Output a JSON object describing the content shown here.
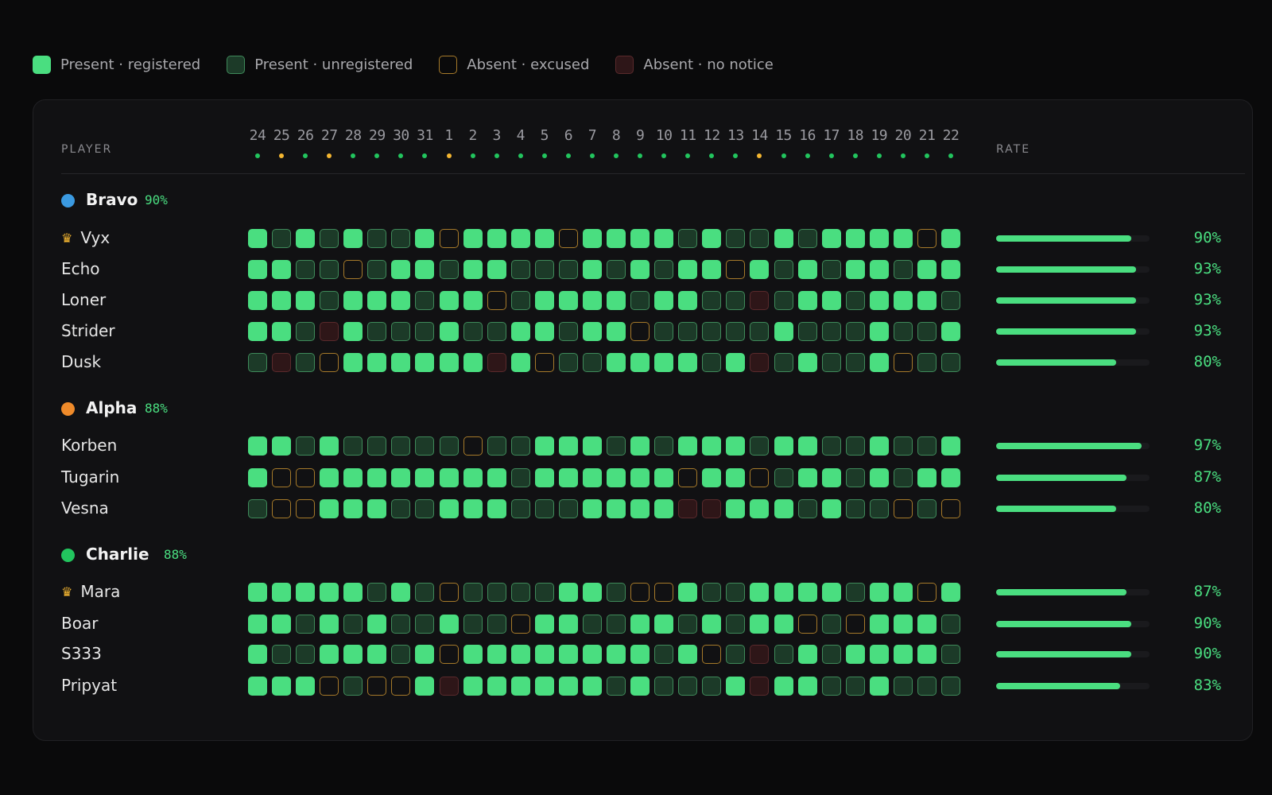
{
  "colors": {
    "registered": "#4ade80",
    "unregistered": "#1c3a28",
    "excused": "#a67a2a",
    "no_notice": "#5a2a2c",
    "dot_green": "#22c55e",
    "dot_amber": "#f5b731"
  },
  "legend": [
    {
      "label": "Present · registered",
      "status": "reg"
    },
    {
      "label": "Present · unregistered",
      "status": "unreg"
    },
    {
      "label": "Absent · excused",
      "status": "exc"
    },
    {
      "label": "Absent · no notice",
      "status": "nonotice"
    }
  ],
  "header": {
    "player": "PLAYER",
    "rate": "RATE"
  },
  "days": [
    "24",
    "25",
    "26",
    "27",
    "28",
    "29",
    "30",
    "31",
    "1",
    "2",
    "3",
    "4",
    "5",
    "6",
    "7",
    "8",
    "9",
    "10",
    "11",
    "12",
    "13",
    "14",
    "15",
    "16",
    "17",
    "18",
    "19",
    "20",
    "21",
    "22"
  ],
  "day_dot_colors": [
    "green",
    "amber",
    "green",
    "amber",
    "green",
    "green",
    "green",
    "green",
    "amber",
    "green",
    "green",
    "green",
    "green",
    "green",
    "green",
    "green",
    "green",
    "green",
    "green",
    "green",
    "green",
    "amber",
    "green",
    "green",
    "green",
    "green",
    "green",
    "green",
    "green",
    "green"
  ],
  "groups": [
    {
      "name": "Bravo",
      "pct": "90%",
      "color": "#3b9ae1",
      "players": [
        {
          "name": "Vyx",
          "crown": true,
          "rate": "90%",
          "rate_value": 0.9,
          "days": [
            "reg",
            "unreg",
            "reg",
            "unreg",
            "reg",
            "unreg",
            "unreg",
            "reg",
            "exc",
            "reg",
            "reg",
            "reg",
            "reg",
            "exc",
            "reg",
            "reg",
            "reg",
            "reg",
            "unreg",
            "reg",
            "unreg",
            "unreg",
            "reg",
            "unreg",
            "reg",
            "reg",
            "reg",
            "reg",
            "exc",
            "reg"
          ]
        },
        {
          "name": "Echo",
          "crown": false,
          "rate": "93%",
          "rate_value": 0.93,
          "days": [
            "reg",
            "reg",
            "unreg",
            "unreg",
            "exc",
            "unreg",
            "reg",
            "reg",
            "unreg",
            "reg",
            "reg",
            "unreg",
            "unreg",
            "unreg",
            "reg",
            "unreg",
            "reg",
            "unreg",
            "reg",
            "reg",
            "exc",
            "reg",
            "unreg",
            "reg",
            "unreg",
            "reg",
            "reg",
            "unreg",
            "reg",
            "reg"
          ]
        },
        {
          "name": "Loner",
          "crown": false,
          "rate": "93%",
          "rate_value": 0.93,
          "days": [
            "reg",
            "reg",
            "reg",
            "unreg",
            "reg",
            "reg",
            "reg",
            "unreg",
            "reg",
            "reg",
            "exc",
            "unreg",
            "reg",
            "reg",
            "reg",
            "reg",
            "unreg",
            "reg",
            "reg",
            "unreg",
            "unreg",
            "nonotice",
            "unreg",
            "reg",
            "reg",
            "unreg",
            "reg",
            "reg",
            "reg",
            "unreg"
          ]
        },
        {
          "name": "Strider",
          "crown": false,
          "rate": "93%",
          "rate_value": 0.93,
          "days": [
            "reg",
            "reg",
            "unreg",
            "nonotice",
            "reg",
            "unreg",
            "unreg",
            "unreg",
            "reg",
            "unreg",
            "unreg",
            "reg",
            "reg",
            "unreg",
            "reg",
            "reg",
            "exc",
            "unreg",
            "unreg",
            "unreg",
            "unreg",
            "unreg",
            "reg",
            "unreg",
            "unreg",
            "unreg",
            "reg",
            "unreg",
            "unreg",
            "reg"
          ]
        },
        {
          "name": "Dusk",
          "crown": false,
          "rate": "80%",
          "rate_value": 0.8,
          "days": [
            "unreg",
            "nonotice",
            "unreg",
            "exc",
            "reg",
            "reg",
            "reg",
            "reg",
            "reg",
            "reg",
            "nonotice",
            "reg",
            "exc",
            "unreg",
            "unreg",
            "reg",
            "reg",
            "reg",
            "reg",
            "unreg",
            "reg",
            "nonotice",
            "unreg",
            "reg",
            "unreg",
            "unreg",
            "reg",
            "exc",
            "unreg",
            "unreg"
          ]
        }
      ]
    },
    {
      "name": "Alpha",
      "pct": "88%",
      "color": "#ee8a2a",
      "players": [
        {
          "name": "Korben",
          "crown": false,
          "rate": "97%",
          "rate_value": 0.97,
          "days": [
            "reg",
            "reg",
            "unreg",
            "reg",
            "unreg",
            "unreg",
            "unreg",
            "unreg",
            "unreg",
            "exc",
            "unreg",
            "unreg",
            "reg",
            "reg",
            "reg",
            "unreg",
            "reg",
            "unreg",
            "reg",
            "reg",
            "reg",
            "unreg",
            "reg",
            "reg",
            "unreg",
            "unreg",
            "reg",
            "unreg",
            "unreg",
            "reg"
          ]
        },
        {
          "name": "Tugarin",
          "crown": false,
          "rate": "87%",
          "rate_value": 0.87,
          "days": [
            "reg",
            "exc",
            "exc",
            "reg",
            "reg",
            "reg",
            "reg",
            "reg",
            "reg",
            "reg",
            "reg",
            "unreg",
            "reg",
            "reg",
            "reg",
            "reg",
            "reg",
            "reg",
            "exc",
            "reg",
            "reg",
            "exc",
            "unreg",
            "reg",
            "reg",
            "unreg",
            "reg",
            "unreg",
            "reg",
            "reg"
          ]
        },
        {
          "name": "Vesna",
          "crown": false,
          "rate": "80%",
          "rate_value": 0.8,
          "days": [
            "unreg",
            "exc",
            "exc",
            "reg",
            "reg",
            "reg",
            "unreg",
            "unreg",
            "reg",
            "reg",
            "reg",
            "unreg",
            "unreg",
            "unreg",
            "reg",
            "reg",
            "reg",
            "reg",
            "nonotice",
            "nonotice",
            "reg",
            "reg",
            "reg",
            "unreg",
            "reg",
            "unreg",
            "unreg",
            "exc",
            "unreg",
            "exc"
          ]
        }
      ]
    },
    {
      "name": "Charlie",
      "pct": "88%",
      "color": "#22c55e",
      "players": [
        {
          "name": "Mara",
          "crown": true,
          "rate": "87%",
          "rate_value": 0.87,
          "days": [
            "reg",
            "reg",
            "reg",
            "reg",
            "reg",
            "unreg",
            "reg",
            "unreg",
            "exc",
            "unreg",
            "unreg",
            "unreg",
            "unreg",
            "reg",
            "reg",
            "unreg",
            "exc",
            "exc",
            "reg",
            "unreg",
            "unreg",
            "reg",
            "reg",
            "reg",
            "reg",
            "unreg",
            "reg",
            "reg",
            "exc",
            "reg"
          ]
        },
        {
          "name": "Boar",
          "crown": false,
          "rate": "90%",
          "rate_value": 0.9,
          "days": [
            "reg",
            "reg",
            "unreg",
            "reg",
            "unreg",
            "reg",
            "unreg",
            "unreg",
            "reg",
            "unreg",
            "unreg",
            "exc",
            "reg",
            "reg",
            "unreg",
            "unreg",
            "reg",
            "reg",
            "unreg",
            "reg",
            "unreg",
            "reg",
            "reg",
            "exc",
            "unreg",
            "exc",
            "reg",
            "reg",
            "reg",
            "unreg"
          ]
        },
        {
          "name": "S333",
          "crown": false,
          "rate": "90%",
          "rate_value": 0.9,
          "days": [
            "reg",
            "unreg",
            "unreg",
            "reg",
            "reg",
            "reg",
            "unreg",
            "reg",
            "exc",
            "reg",
            "reg",
            "reg",
            "reg",
            "reg",
            "reg",
            "reg",
            "reg",
            "unreg",
            "reg",
            "exc",
            "unreg",
            "nonotice",
            "unreg",
            "reg",
            "unreg",
            "reg",
            "reg",
            "reg",
            "reg",
            "unreg"
          ]
        },
        {
          "name": "Pripyat",
          "crown": false,
          "rate": "83%",
          "rate_value": 0.83,
          "days": [
            "reg",
            "reg",
            "reg",
            "exc",
            "unreg",
            "exc",
            "exc",
            "reg",
            "nonotice",
            "reg",
            "reg",
            "reg",
            "reg",
            "reg",
            "reg",
            "unreg",
            "reg",
            "unreg",
            "unreg",
            "unreg",
            "reg",
            "nonotice",
            "reg",
            "reg",
            "unreg",
            "unreg",
            "reg",
            "unreg",
            "unreg",
            "unreg"
          ]
        }
      ]
    }
  ]
}
